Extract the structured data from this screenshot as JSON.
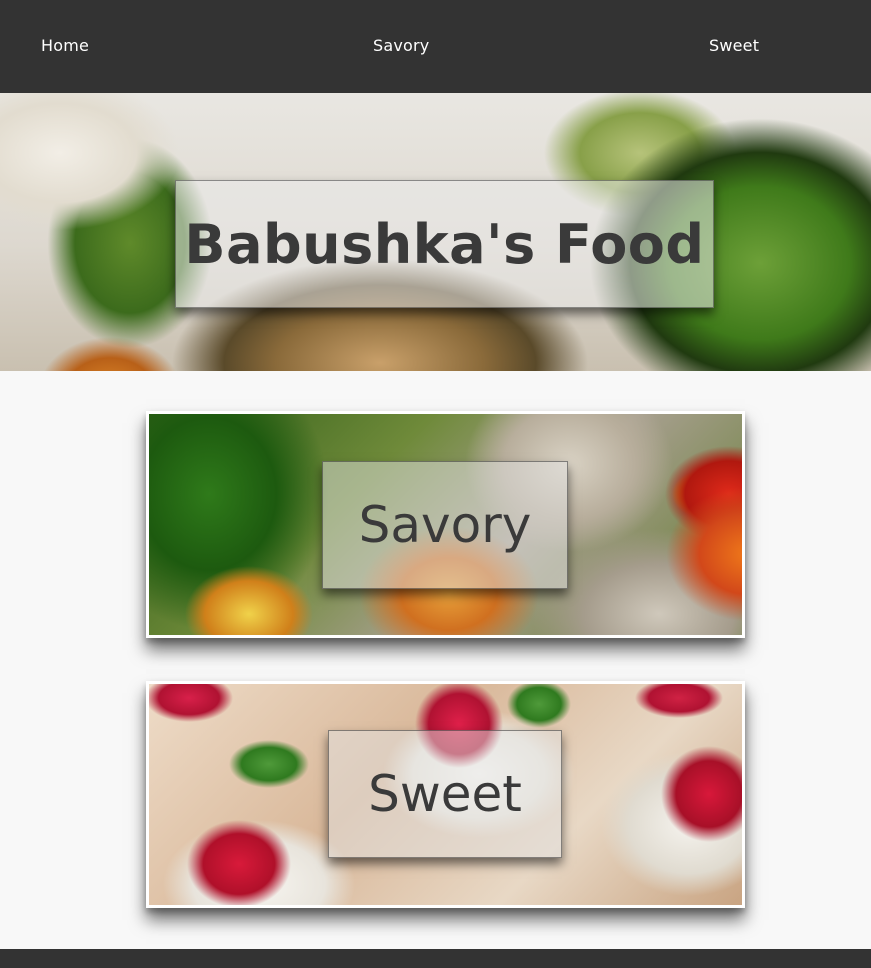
{
  "nav": {
    "home_label": "Home",
    "savory_label": "Savory",
    "sweet_label": "Sweet"
  },
  "hero": {
    "title": "Babushka's Food"
  },
  "categories": [
    {
      "label": "Savory"
    },
    {
      "label": "Sweet"
    }
  ],
  "footer": {
    "text": ""
  },
  "colors": {
    "nav_background": "#333333",
    "page_background": "#f8f8f8",
    "footer_background": "#333333"
  }
}
